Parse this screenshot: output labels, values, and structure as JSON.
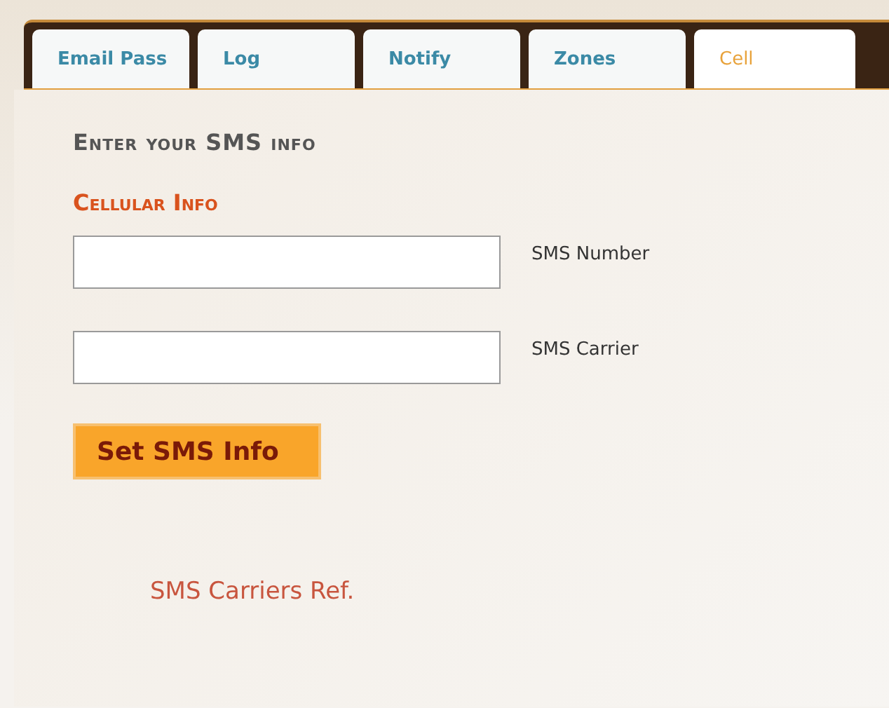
{
  "tabs": [
    {
      "label": "Email Pass",
      "selected": false
    },
    {
      "label": "Log",
      "selected": false
    },
    {
      "label": "Notify",
      "selected": false
    },
    {
      "label": "Zones",
      "selected": false
    },
    {
      "label": "Cell",
      "selected": true
    }
  ],
  "heading": "Enter your SMS info",
  "section_title": "Cellular Info",
  "fields": [
    {
      "label": "SMS Number"
    },
    {
      "label": "SMS Carrier"
    }
  ],
  "submit_button": "Set SMS Info",
  "link": "SMS Carriers Ref."
}
